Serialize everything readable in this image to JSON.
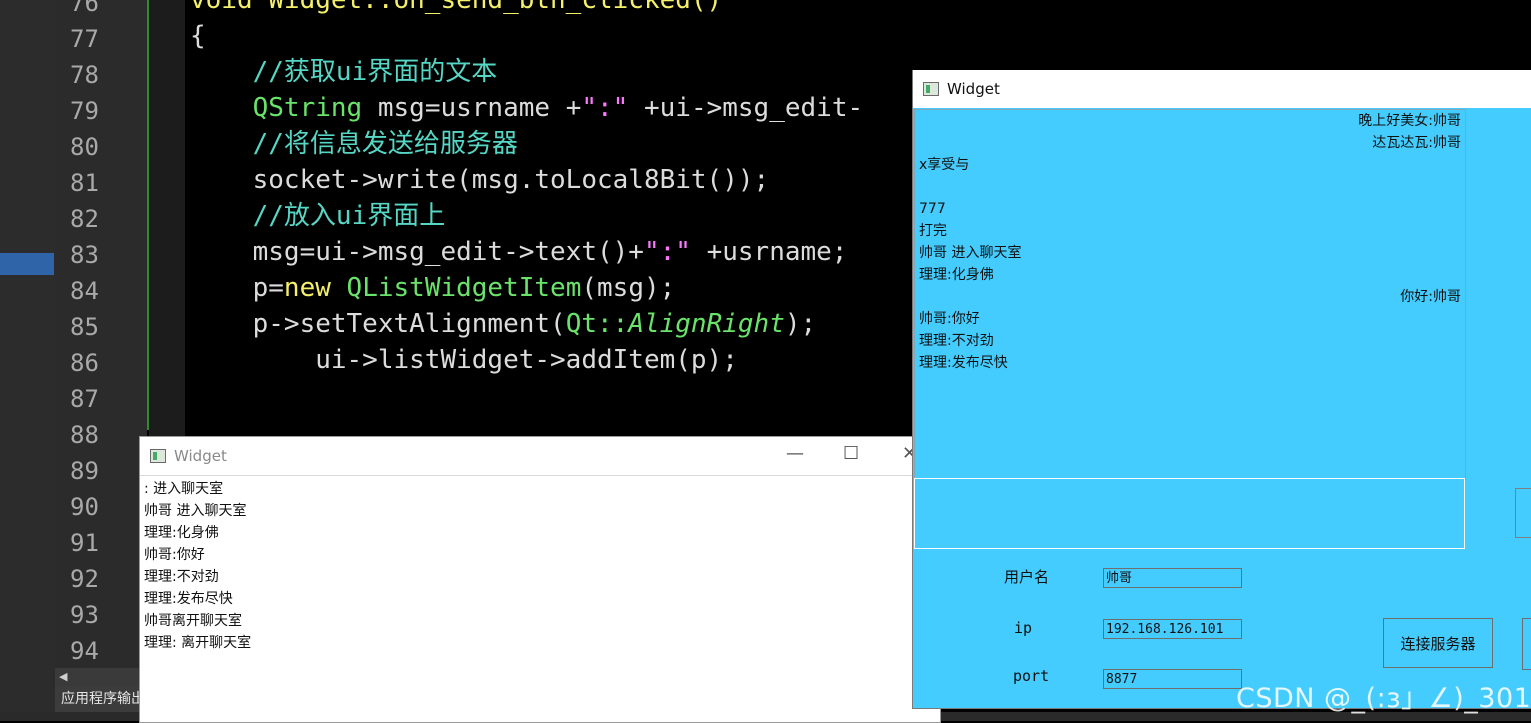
{
  "ide": {
    "line_numbers": [
      "76",
      "77",
      "78",
      "79",
      "80",
      "81",
      "82",
      "83",
      "84",
      "85",
      "86",
      "87",
      "88",
      "89",
      "90",
      "91",
      "92",
      "93",
      "94"
    ],
    "code_lines": [
      [
        {
          "t": "void Widget::on_send_btn_clicked()",
          "c": "c-keyword"
        }
      ],
      [
        {
          "t": "{",
          "c": ""
        }
      ],
      [
        {
          "t": "    //获取ui界面的文本",
          "c": "c-comment"
        }
      ],
      [
        {
          "t": "    ",
          "c": ""
        },
        {
          "t": "QString",
          "c": "c-type"
        },
        {
          "t": " msg=usrname +",
          "c": ""
        },
        {
          "t": "\":\"",
          "c": "c-string"
        },
        {
          "t": " +ui->msg_edit-",
          "c": ""
        }
      ],
      [
        {
          "t": "    //将信息发送给服务器",
          "c": "c-comment"
        }
      ],
      [
        {
          "t": "    socket->write(msg.toLocal8Bit());",
          "c": ""
        }
      ],
      [
        {
          "t": "    //放入ui界面上",
          "c": "c-comment"
        }
      ],
      [
        {
          "t": "    msg=ui->msg_edit->text()+",
          "c": ""
        },
        {
          "t": "\":\"",
          "c": "c-string"
        },
        {
          "t": " +usrname;",
          "c": ""
        }
      ],
      [
        {
          "t": "    p=",
          "c": ""
        },
        {
          "t": "new",
          "c": "c-keyword"
        },
        {
          "t": " ",
          "c": ""
        },
        {
          "t": "QListWidgetItem",
          "c": "c-type"
        },
        {
          "t": "(msg);",
          "c": ""
        }
      ],
      [
        {
          "t": "    p->setTextAlignment(",
          "c": ""
        },
        {
          "t": "Qt::",
          "c": "c-type"
        },
        {
          "t": "AlignRight",
          "c": "c-italic"
        },
        {
          "t": ");",
          "c": ""
        }
      ],
      [
        {
          "t": "        ui->listWidget->addItem(p);",
          "c": ""
        }
      ]
    ],
    "output_tab_label": "应用程序输出"
  },
  "window_back": {
    "title": "Widget",
    "min_glyph": "—",
    "max_glyph": "☐",
    "close_glyph": "✕",
    "items": [
      ": 进入聊天室",
      "帅哥 进入聊天室",
      "理理:化身佛",
      "帅哥:你好",
      "理理:不对劲",
      "理理:发布尽快",
      "帅哥离开聊天室",
      "理理: 离开聊天室"
    ]
  },
  "window_front": {
    "title": "Widget",
    "items": [
      {
        "text": "晚上好美女:帅哥",
        "align": "right"
      },
      {
        "text": "达瓦达瓦:帅哥",
        "align": "right"
      },
      {
        "text": "x享受与",
        "align": "left"
      },
      {
        "text": "",
        "align": "left"
      },
      {
        "text": "777",
        "align": "left"
      },
      {
        "text": "打完",
        "align": "left"
      },
      {
        "text": "帅哥 进入聊天室",
        "align": "left"
      },
      {
        "text": "理理:化身佛",
        "align": "left"
      },
      {
        "text": "你好:帅哥",
        "align": "right"
      },
      {
        "text": "帅哥:你好",
        "align": "left"
      },
      {
        "text": "理理:不对劲",
        "align": "left"
      },
      {
        "text": "理理:发布尽快",
        "align": "left"
      }
    ],
    "username_label": "用户名",
    "username_value": "帅哥",
    "ip_label": "ip",
    "ip_value": "192.168.126.101",
    "port_label": "port",
    "port_value": "8877",
    "connect_label": "连接服务器"
  },
  "watermark": "CSDN @_(:з」∠)_301"
}
